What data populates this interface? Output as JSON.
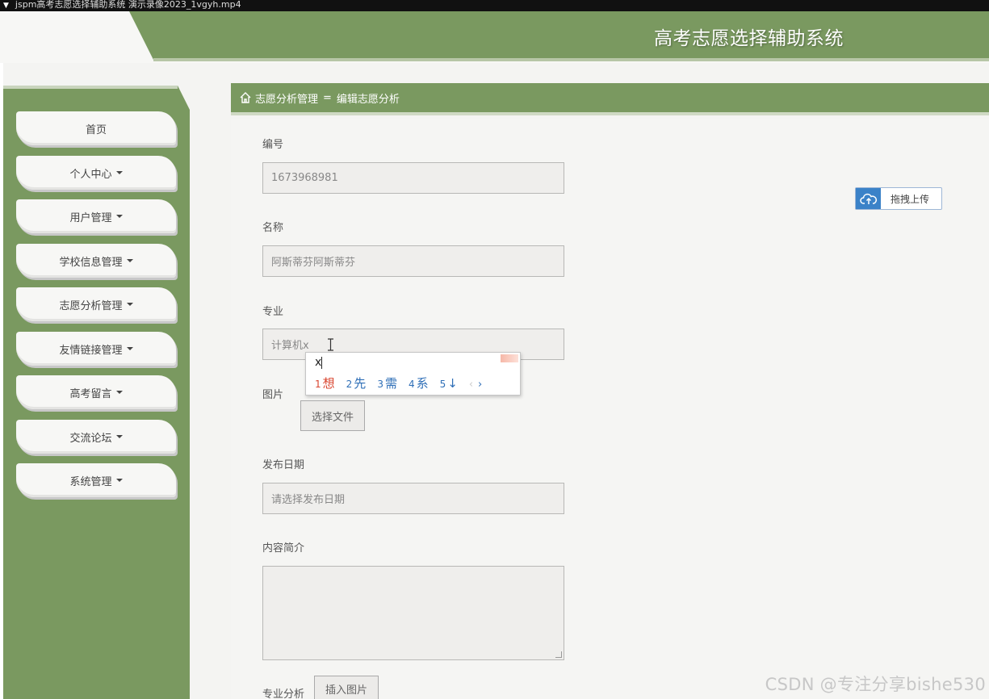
{
  "window": {
    "title": "jspm高考志愿选择辅助系统 演示录像2023_1vgyh.mp4"
  },
  "header": {
    "system_title": "高考志愿选择辅助系统"
  },
  "sidebar": {
    "items": [
      {
        "label": "首页",
        "has_caret": false
      },
      {
        "label": "个人中心",
        "has_caret": true
      },
      {
        "label": "用户管理",
        "has_caret": true
      },
      {
        "label": "学校信息管理",
        "has_caret": true
      },
      {
        "label": "志愿分析管理",
        "has_caret": true
      },
      {
        "label": "友情链接管理",
        "has_caret": true
      },
      {
        "label": "高考留言",
        "has_caret": true
      },
      {
        "label": "交流论坛",
        "has_caret": true
      },
      {
        "label": "系统管理",
        "has_caret": true
      }
    ]
  },
  "breadcrumb": {
    "section": "志愿分析管理",
    "separator": "=",
    "page": "编辑志愿分析"
  },
  "form": {
    "id_label": "编号",
    "id_value": "1673968981",
    "name_label": "名称",
    "name_value": "阿斯蒂芬阿斯蒂芬",
    "major_label": "专业",
    "major_value": "计算机x",
    "image_label": "图片",
    "choose_file_button": "选择文件",
    "date_label": "发布日期",
    "date_placeholder": "请选择发布日期",
    "intro_label": "内容简介",
    "analysis_label": "专业分析",
    "insert_image_button": "插入图片",
    "upload_button": "拖拽上传"
  },
  "ime": {
    "typed": "x",
    "candidates": [
      {
        "num": "1",
        "text": "想"
      },
      {
        "num": "2",
        "text": "先"
      },
      {
        "num": "3",
        "text": "需"
      },
      {
        "num": "4",
        "text": "系"
      },
      {
        "num": "5",
        "text": "↓"
      }
    ],
    "prev": "‹",
    "next": "›"
  },
  "watermark": "CSDN @专注分享bishe530"
}
